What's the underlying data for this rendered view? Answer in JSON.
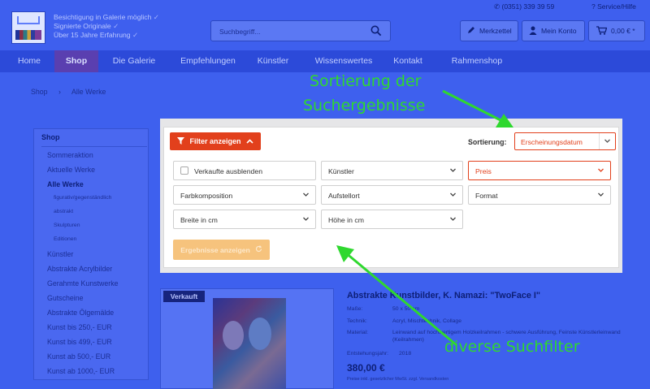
{
  "header": {
    "usp": [
      "Besichtigung in Galerie möglich",
      "Signierte Originale",
      "Über 15 Jahre Erfahrung"
    ],
    "usp_check": "✓",
    "phone": "(0351) 339 39 59",
    "service": "Service/Hilfe",
    "search_placeholder": "Suchbegriff...",
    "merkzettel": "Merkzettel",
    "konto": "Mein Konto",
    "cart": "0,00 € *"
  },
  "nav": [
    "Home",
    "Shop",
    "Die Galerie",
    "Empfehlungen",
    "Künstler",
    "Wissenswertes",
    "Kontakt",
    "Rahmenshop"
  ],
  "breadcrumb": {
    "first": "Shop",
    "sep": "›",
    "second": "Alle Werke"
  },
  "sidebar": {
    "title": "Shop",
    "items": [
      "Sommeraktion",
      "Aktuelle Werke",
      "Alle Werke",
      "figurativ/gegenständlich",
      "abstrakt",
      "Skulpturen",
      "Editionen",
      "Künstler",
      "Abstrakte Acrylbilder",
      "Gerahmte Kunstwerke",
      "Gutscheine",
      "Abstrakte Ölgemälde",
      "Kunst bis 250,- EUR",
      "Kunst bis 499,- EUR",
      "Kunst ab 500,- EUR",
      "Kunst ab 1000,- EUR"
    ]
  },
  "filter": {
    "toggle_label": "Filter anzeigen",
    "sort_label": "Sortierung:",
    "sort_value": "Erscheinungsdatum",
    "fields": [
      "Verkaufte ausblenden",
      "Künstler",
      "Preis",
      "Farbkomposition",
      "Aufstellort",
      "Format",
      "Breite in cm",
      "Höhe in cm"
    ],
    "results_button": "Ergebnisse anzeigen"
  },
  "product": {
    "tag": "Verkauft",
    "title": "Abstrakte Kunstbilder, K. Namazi: \"TwoFace I\"",
    "details": [
      {
        "label": "Maße:",
        "value": "50 x 50 cm"
      },
      {
        "label": "Technik:",
        "value": "Acryl, Mischtechnik, Collage"
      },
      {
        "label": "Material:",
        "value": "Leinwand auf hochwertigem Holzkeilrahmen - schwere Ausführung, Feinste Künstlerleinwand (Keilrahmen)"
      },
      {
        "label": "Entstehungsjahr:",
        "value": "2018"
      }
    ],
    "price": "380,00 €",
    "note": "Preise inkl. gesetzlicher MwSt. zzgl. Versandkosten"
  },
  "annotations": {
    "sort_line1": "Sortierung der",
    "sort_line2": "Suchergebnisse",
    "filter": "diverse Suchfilter"
  },
  "colors": {
    "overlay_blue": "#3e60ee",
    "accent_red": "#e2401c",
    "annotation_green": "#2fd82f",
    "shop_active": "#5a3fb0"
  }
}
